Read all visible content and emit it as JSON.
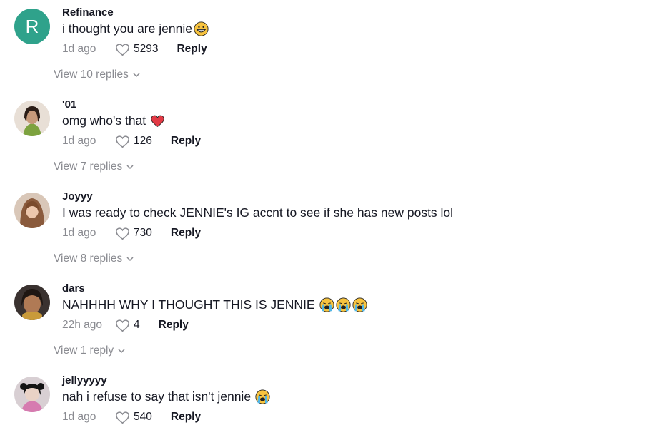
{
  "comments": [
    {
      "username": "Refinance",
      "avatar": {
        "type": "letter",
        "letter": "R",
        "color": "#2fa28b"
      },
      "text": "i thought you are jennie",
      "emojis": [
        "grinning-face"
      ],
      "time": "1d ago",
      "likes": "5293",
      "reply_label": "Reply",
      "view_replies": "View 10 replies"
    },
    {
      "username": "'01",
      "avatar": {
        "type": "photo"
      },
      "text": "omg who's that",
      "emojis": [
        "red-heart"
      ],
      "time": "1d ago",
      "likes": "126",
      "reply_label": "Reply",
      "view_replies": "View 7 replies"
    },
    {
      "username": "Joyyy",
      "avatar": {
        "type": "photo"
      },
      "text": "I was ready to check JENNIE's IG accnt to see if she has new posts lol",
      "emojis": [],
      "time": "1d ago",
      "likes": "730",
      "reply_label": "Reply",
      "view_replies": "View 8 replies"
    },
    {
      "username": "dars",
      "avatar": {
        "type": "photo"
      },
      "text": "NAHHHH WHY I THOUGHT THIS IS JENNIE",
      "emojis": [
        "loudly-crying-face",
        "loudly-crying-face",
        "loudly-crying-face"
      ],
      "time": "22h ago",
      "likes": "4",
      "reply_label": "Reply",
      "view_replies": "View 1 reply"
    },
    {
      "username": "jellyyyyy",
      "avatar": {
        "type": "photo"
      },
      "text": "nah i refuse to say that isn't jennie",
      "emojis": [
        "loudly-crying-face"
      ],
      "time": "1d ago",
      "likes": "540",
      "reply_label": "Reply",
      "view_replies": ""
    }
  ]
}
